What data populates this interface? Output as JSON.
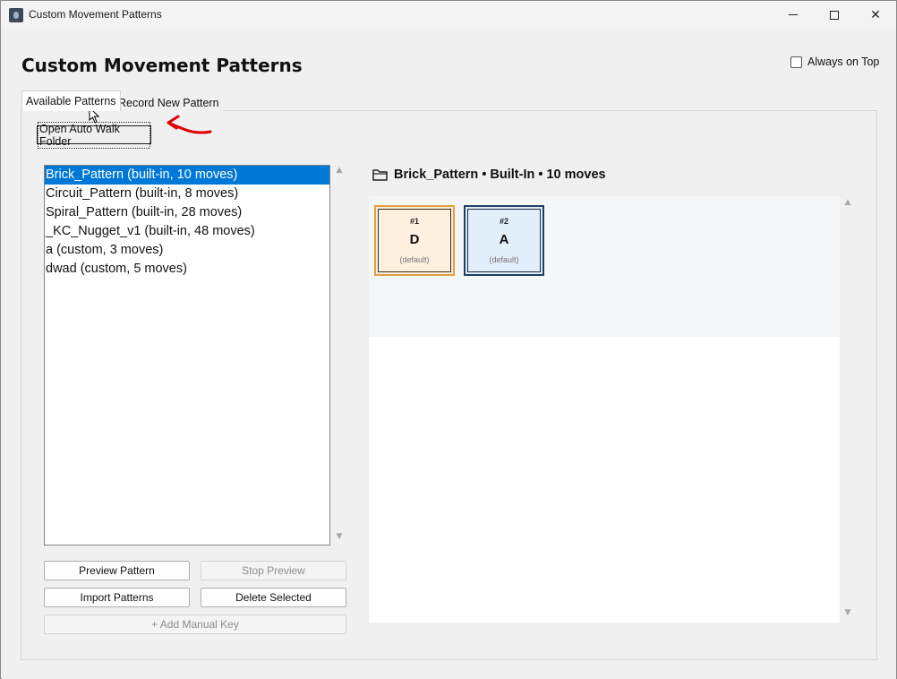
{
  "window": {
    "title": "Custom Movement Patterns",
    "controls": {
      "minimize": "minimize",
      "maximize": "maximize",
      "close": "✕"
    }
  },
  "header": {
    "title": "Custom Movement Patterns",
    "always_on_top_label": "Always on Top",
    "always_on_top_checked": false
  },
  "tabs": [
    {
      "label": "Available Patterns",
      "active": true
    },
    {
      "label": "Record New Pattern",
      "active": false
    }
  ],
  "toolbar": {
    "open_folder_label": "Open Auto Walk Folder"
  },
  "patterns_list": {
    "items": [
      {
        "label": "Brick_Pattern (built-in, 10 moves)",
        "selected": true
      },
      {
        "label": "Circuit_Pattern (built-in, 8 moves)",
        "selected": false
      },
      {
        "label": "Spiral_Pattern (built-in, 28 moves)",
        "selected": false
      },
      {
        "label": "_KC_Nugget_v1 (built-in, 48 moves)",
        "selected": false
      },
      {
        "label": "a (custom, 3 moves)",
        "selected": false
      },
      {
        "label": "dwad (custom, 5 moves)",
        "selected": false
      }
    ]
  },
  "actions": {
    "preview_label": "Preview Pattern",
    "stop_label": "Stop Preview",
    "import_label": "Import Patterns",
    "delete_label": "Delete Selected",
    "add_manual_label": "+ Add Manual Key"
  },
  "detail": {
    "title": "Brick_Pattern • Built-In • 10 moves",
    "icon": "folder-icon",
    "cards": [
      {
        "number": "#1",
        "key": "D",
        "note": "(default)"
      },
      {
        "number": "#2",
        "key": "A",
        "note": "(default)"
      }
    ]
  },
  "colors": {
    "selection": "#0078d7",
    "card1_border": "#e0a040",
    "card1_bg": "#fdf0df",
    "card2_border": "#1f3f66",
    "card2_bg": "#e3eefb",
    "annotation_arrow": "#e00000"
  }
}
